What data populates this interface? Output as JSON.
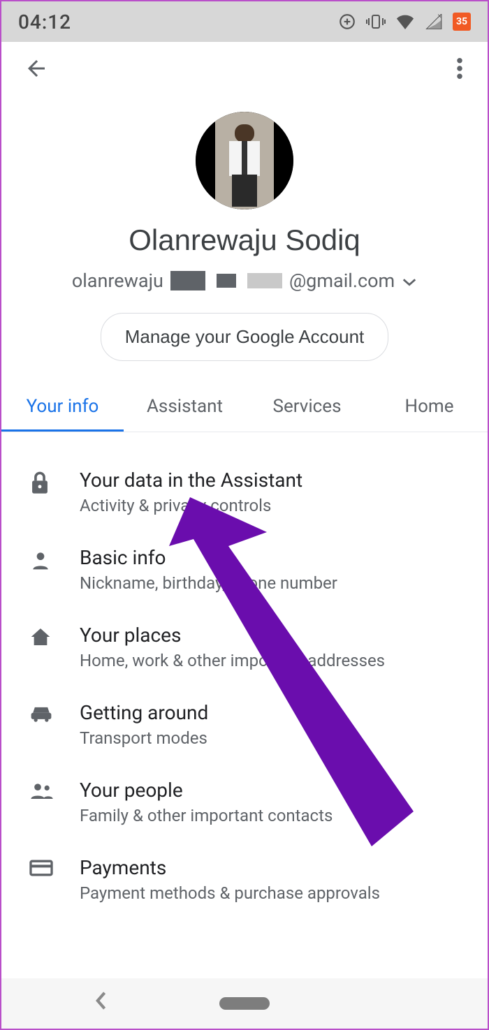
{
  "status": {
    "time": "04:12",
    "calendar_badge": "35"
  },
  "profile": {
    "name": "Olanrewaju Sodiq",
    "email_prefix": "olanrewaju",
    "email_suffix": "@gmail.com",
    "manage_button": "Manage your Google Account"
  },
  "tabs": [
    {
      "label": "Your info",
      "active": true
    },
    {
      "label": "Assistant",
      "active": false
    },
    {
      "label": "Services",
      "active": false
    },
    {
      "label": "Home",
      "active": false
    }
  ],
  "settings": [
    {
      "icon": "lock",
      "title": "Your data in the Assistant",
      "sub": "Activity & privacy controls"
    },
    {
      "icon": "person",
      "title": "Basic info",
      "sub": "Nickname, birthday, phone number"
    },
    {
      "icon": "home",
      "title": "Your places",
      "sub": "Home, work & other important addresses"
    },
    {
      "icon": "car",
      "title": "Getting around",
      "sub": "Transport modes"
    },
    {
      "icon": "people",
      "title": "Your people",
      "sub": "Family & other important contacts"
    },
    {
      "icon": "card",
      "title": "Payments",
      "sub": "Payment methods & purchase approvals"
    }
  ],
  "annotation": {
    "color": "#6a0dad"
  }
}
